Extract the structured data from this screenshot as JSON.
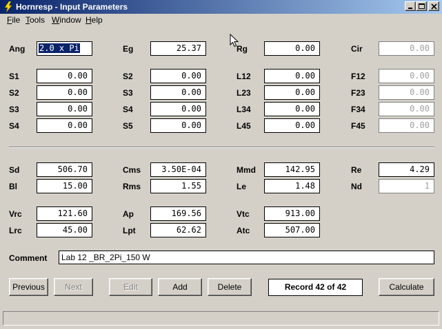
{
  "window": {
    "title": "Hornresp - Input Parameters"
  },
  "menu": [
    "File",
    "Tools",
    "Window",
    "Help"
  ],
  "params": {
    "Ang": {
      "label": "Ang",
      "value": "2.0 x Pi"
    },
    "Eg": {
      "label": "Eg",
      "value": "25.37"
    },
    "Rg": {
      "label": "Rg",
      "value": "0.00"
    },
    "Cir": {
      "label": "Cir",
      "value": "0.00"
    },
    "S1": {
      "label": "S1",
      "value": "0.00"
    },
    "S2a": {
      "label": "S2",
      "value": "0.00"
    },
    "L12": {
      "label": "L12",
      "value": "0.00"
    },
    "F12": {
      "label": "F12",
      "value": "0.00"
    },
    "S2": {
      "label": "S2",
      "value": "0.00"
    },
    "S3a": {
      "label": "S3",
      "value": "0.00"
    },
    "L23": {
      "label": "L23",
      "value": "0.00"
    },
    "F23": {
      "label": "F23",
      "value": "0.00"
    },
    "S3": {
      "label": "S3",
      "value": "0.00"
    },
    "S4a": {
      "label": "S4",
      "value": "0.00"
    },
    "L34": {
      "label": "L34",
      "value": "0.00"
    },
    "F34": {
      "label": "F34",
      "value": "0.00"
    },
    "S4": {
      "label": "S4",
      "value": "0.00"
    },
    "S5": {
      "label": "S5",
      "value": "0.00"
    },
    "L45": {
      "label": "L45",
      "value": "0.00"
    },
    "F45": {
      "label": "F45",
      "value": "0.00"
    },
    "Sd": {
      "label": "Sd",
      "value": "506.70"
    },
    "Cms": {
      "label": "Cms",
      "value": "3.50E-04"
    },
    "Mmd": {
      "label": "Mmd",
      "value": "142.95"
    },
    "Re": {
      "label": "Re",
      "value": "4.29"
    },
    "Bl": {
      "label": "Bl",
      "value": "15.00"
    },
    "Rms": {
      "label": "Rms",
      "value": "1.55"
    },
    "Le": {
      "label": "Le",
      "value": "1.48"
    },
    "Nd": {
      "label": "Nd",
      "value": "1"
    },
    "Vrc": {
      "label": "Vrc",
      "value": "121.60"
    },
    "Ap": {
      "label": "Ap",
      "value": "169.56"
    },
    "Vtc": {
      "label": "Vtc",
      "value": "913.00"
    },
    "Lrc": {
      "label": "Lrc",
      "value": "45.00"
    },
    "Lpt": {
      "label": "Lpt",
      "value": "62.62"
    },
    "Atc": {
      "label": "Atc",
      "value": "507.00"
    }
  },
  "comment": {
    "label": "Comment",
    "value": "Lab 12 _BR_2Pi_150 W"
  },
  "buttons": {
    "previous": "Previous",
    "next": "Next",
    "edit": "Edit",
    "add": "Add",
    "delete": "Delete",
    "calculate": "Calculate"
  },
  "record": "Record 42 of 42"
}
